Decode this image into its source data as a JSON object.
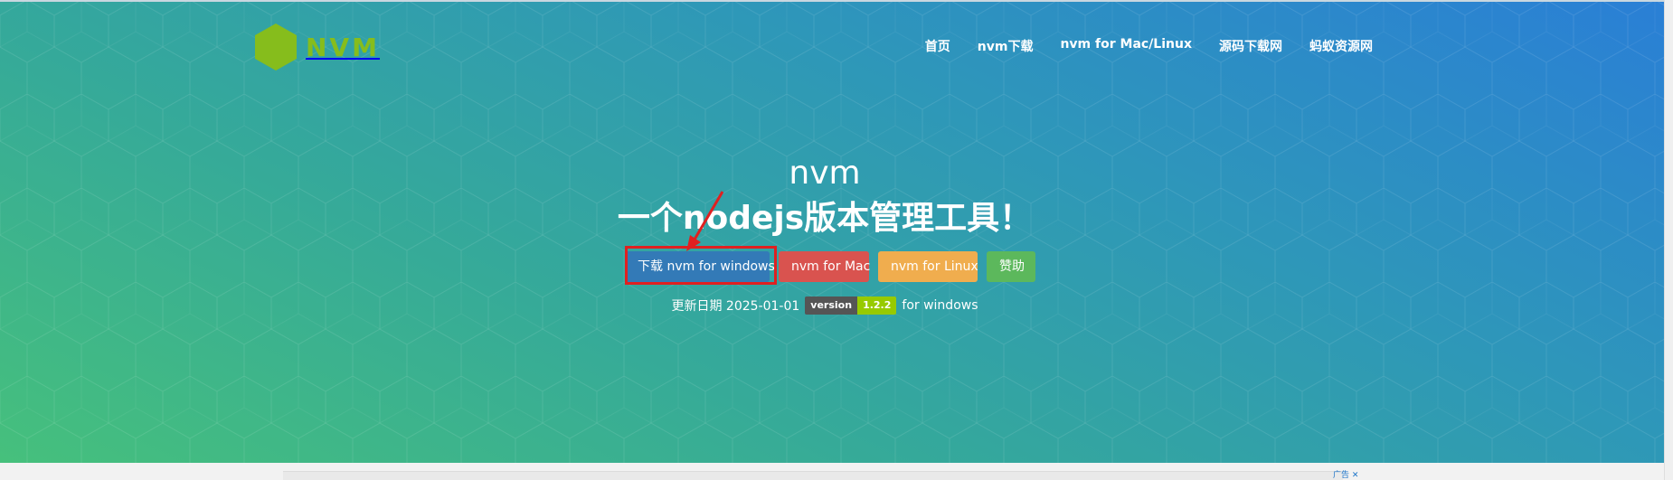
{
  "logo": {
    "text": "NVM",
    "color": "#86bd1c"
  },
  "nav": {
    "items": [
      {
        "label": "首页"
      },
      {
        "label": "nvm下载"
      },
      {
        "label": "nvm for Mac/Linux"
      },
      {
        "label": "源码下载网"
      },
      {
        "label": "蚂蚁资源网"
      }
    ]
  },
  "hero": {
    "title": "nvm",
    "subtitle": "一个nodejs版本管理工具！"
  },
  "buttons": {
    "windows": "下载 nvm for windows",
    "mac": "nvm for Mac",
    "linux": "nvm for Linux",
    "donate": "赞助"
  },
  "update": {
    "label": "更新日期 2025-01-01",
    "badge_left": "version",
    "badge_right": "1.2.2",
    "suffix": "for windows"
  },
  "ad": {
    "label": "广告 ✕"
  },
  "colors": {
    "primary": "#337ab7",
    "danger": "#d9534f",
    "warning": "#f0ad4e",
    "success": "#5cb85c",
    "highlight": "#e02020"
  }
}
